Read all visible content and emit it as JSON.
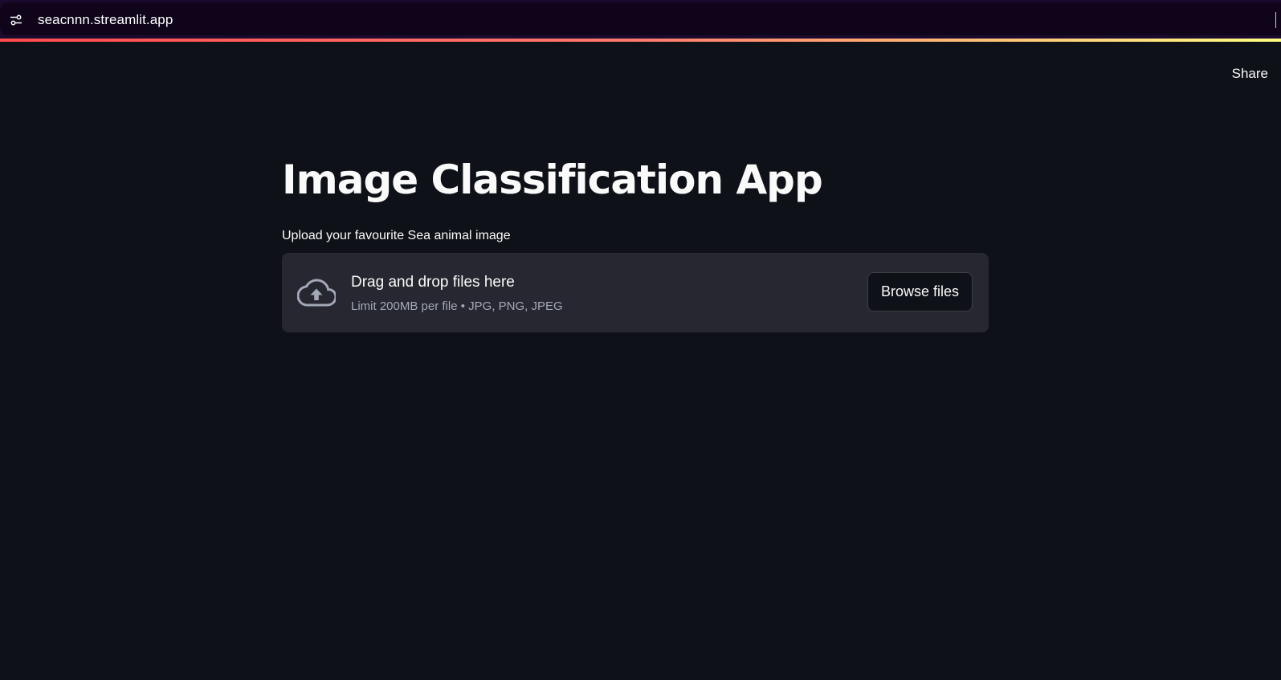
{
  "browser": {
    "url": "seacnnn.streamlit.app",
    "site_info_icon": "tune-icon"
  },
  "header": {
    "share_label": "Share"
  },
  "main": {
    "title": "Image Classification App",
    "uploader": {
      "label": "Upload your favourite Sea animal image",
      "dropzone_title": "Drag and drop files here",
      "dropzone_subtitle": "Limit 200MB per file • JPG, PNG, JPEG",
      "browse_label": "Browse files",
      "icon": "cloud-upload-icon"
    }
  },
  "colors": {
    "background": "#0e1117",
    "dropzone": "#262730",
    "browser_bar": "#0f0419",
    "accent_start": "#ff4b4b",
    "accent_end": "#fffd80"
  }
}
